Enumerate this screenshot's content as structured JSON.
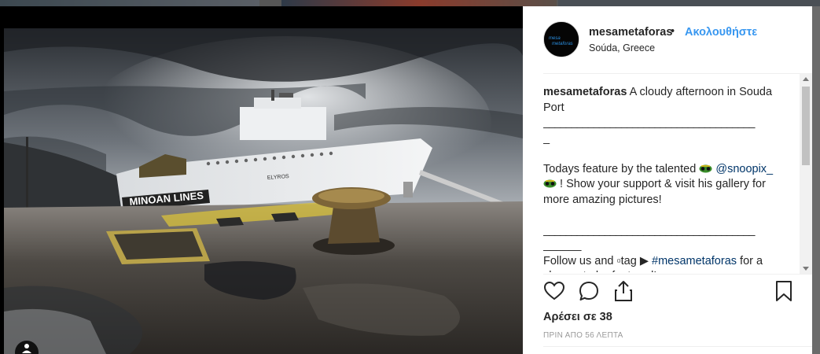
{
  "post": {
    "username": "mesametaforas",
    "separator": "•",
    "follow_label": "Ακολουθήστε",
    "location": "Soúda, Greece",
    "caption": {
      "user": "mesametaforas",
      "line1": "A cloudy afternoon in Souda Port",
      "rule1": "______________________________________",
      "rule1_tail": "_",
      "feature_pre": "Todays feature by the talented",
      "handle": "@snoopix_",
      "feature_post": "! Show your support & visit his gallery for more amazing pictures!",
      "rule2": "______________________________________",
      "rule2_tail": "______",
      "follow_pre": "Follow us and ▫tag ▶",
      "hashtag": "#mesametaforas",
      "follow_post": "for a chance to be featured!"
    },
    "likes": "Αρέσει σε 38",
    "timestamp": "ΠΡΙΝ ΑΠΟ 56 ΛΕΠΤΑ"
  },
  "photo": {
    "hull_text": "ELYROS",
    "lines_text": "MINOAN LINES"
  },
  "icons": {
    "like": "heart-icon",
    "comment": "comment-icon",
    "share": "share-icon",
    "save": "bookmark-icon",
    "user_tag": "user-icon"
  },
  "colors": {
    "follow": "#3897f0",
    "link": "#003569",
    "text": "#262626",
    "muted": "#999999"
  }
}
